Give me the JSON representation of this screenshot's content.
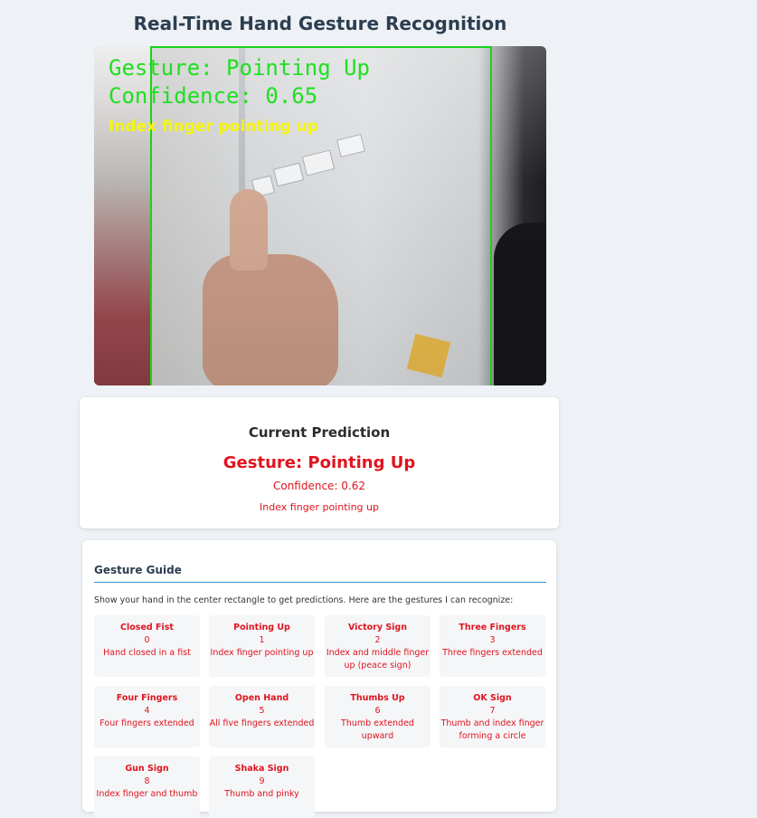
{
  "page": {
    "title": "Real-Time Hand Gesture Recognition"
  },
  "video_overlay": {
    "gesture": "Gesture: Pointing Up",
    "confidence": "Confidence: 0.65",
    "description": "Index finger pointing up"
  },
  "prediction": {
    "heading": "Current Prediction",
    "gesture": "Gesture: Pointing Up",
    "confidence": "Confidence: 0.62",
    "description": "Index finger pointing up"
  },
  "guide": {
    "title": "Gesture Guide",
    "intro": "Show your hand in the center rectangle to get predictions. Here are the gestures I can recognize:",
    "gestures": [
      {
        "name": "Closed Fist",
        "id": "0",
        "desc": "Hand closed in a fist"
      },
      {
        "name": "Pointing Up",
        "id": "1",
        "desc": "Index finger pointing up"
      },
      {
        "name": "Victory Sign",
        "id": "2",
        "desc": "Index and middle finger up (peace sign)"
      },
      {
        "name": "Three Fingers",
        "id": "3",
        "desc": "Three fingers extended"
      },
      {
        "name": "Four Fingers",
        "id": "4",
        "desc": "Four fingers extended"
      },
      {
        "name": "Open Hand",
        "id": "5",
        "desc": "All five fingers extended"
      },
      {
        "name": "Thumbs Up",
        "id": "6",
        "desc": "Thumb extended upward"
      },
      {
        "name": "OK Sign",
        "id": "7",
        "desc": "Thumb and index finger forming a circle"
      },
      {
        "name": "Gun Sign",
        "id": "8",
        "desc": "Index finger and thumb"
      },
      {
        "name": "Shaka Sign",
        "id": "9",
        "desc": "Thumb and pinky"
      }
    ]
  },
  "colors": {
    "accent_red": "#e0141e",
    "overlay_green": "#1ee01e",
    "overlay_yellow": "#f5f50f",
    "divider_blue": "#3a8fd0"
  }
}
